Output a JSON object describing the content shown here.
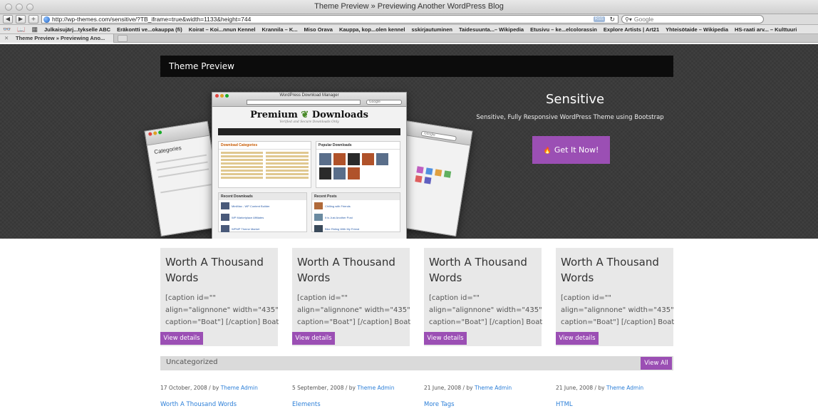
{
  "browser": {
    "window_title": "Theme Preview » Previewing Another WordPress Blog",
    "url": "http://wp-themes.com/sensitive/?TB_iframe=true&width=1133&height=744",
    "rss_label": "RSS",
    "search_placeholder": "Google",
    "bookmarks": [
      "Julkaisujärj...tykselle ABC",
      "Eräkontti ve...okauppa (fi)",
      "Koirat – Koi...nnun Kennel",
      "Krannila – K...",
      "Miso Orava",
      "Kauppa, kop...olen kennel",
      "sskirjautuminen",
      "Taidesuunta...– Wikipedia",
      "Etusivu – ke...elcolorassin",
      "Explore Artists | Art21",
      "Yhteisötaide – Wikipedia",
      "HS-raati arv... – Kulttuuri"
    ],
    "tab_title": "Theme Preview » Previewing Ano..."
  },
  "page": {
    "preview_bar_title": "Theme Preview",
    "hero": {
      "title": "Sensitive",
      "subtitle": "Sensitive, Fully Responsive WordPress Theme using Bootstrap",
      "cta_label": "Get It Now!",
      "screenshot": {
        "window_title": "WordPress Download Manager",
        "search_placeholder": "Google",
        "logo_text_1": "Premium",
        "logo_text_2": "Downloads",
        "tagline": "Verified and Secure Downloads Only",
        "box1_title": "Download Categories",
        "box2_title": "Popular Downloads",
        "box3_title": "Recent Downloads",
        "box4_title": "Recent Posts",
        "recent_downloads": [
          "MiniMax - WP Content Builder",
          "WP Marketplace Affiliates",
          "WPMP Theme Market"
        ],
        "recent_posts": [
          "Chilling with Friends",
          "It is Just Another Post",
          "Bike Riding With My Friend"
        ],
        "side_title": "Categories"
      }
    },
    "cards": [
      {
        "title": "Worth A Thousand Words",
        "excerpt": "[caption id=\"\" align=\"alignnone\" width=\"435\" caption=\"Boat\"] [/caption] Boat …",
        "button": "View details"
      },
      {
        "title": "Worth A Thousand Words",
        "excerpt": "[caption id=\"\" align=\"alignnone\" width=\"435\" caption=\"Boat\"] [/caption] Boat …",
        "button": "View details"
      },
      {
        "title": "Worth A Thousand Words",
        "excerpt": "[caption id=\"\" align=\"alignnone\" width=\"435\" caption=\"Boat\"] [/caption] Boat …",
        "button": "View details"
      },
      {
        "title": "Worth A Thousand Words",
        "excerpt": "[caption id=\"\" align=\"alignnone\" width=\"435\" caption=\"Boat\"] [/caption] Boat …",
        "button": "View details"
      }
    ],
    "category": {
      "title": "Uncategorized",
      "view_all": "View All"
    },
    "posts": [
      {
        "date": "17 October, 2008 / by ",
        "author": "Theme Admin",
        "title": "Worth A Thousand Words"
      },
      {
        "date": "5 September, 2008 / by ",
        "author": "Theme Admin",
        "title": "Elements"
      },
      {
        "date": "21 June, 2008 / by ",
        "author": "Theme Admin",
        "title": "More Tags"
      },
      {
        "date": "21 June, 2008 / by ",
        "author": "Theme Admin",
        "title": "HTML"
      }
    ]
  },
  "colors": {
    "accent": "#9b4fb4",
    "hero_bg": "#3b3b3b",
    "card_bg": "#e8e8e8",
    "link": "#2c7fd8"
  }
}
